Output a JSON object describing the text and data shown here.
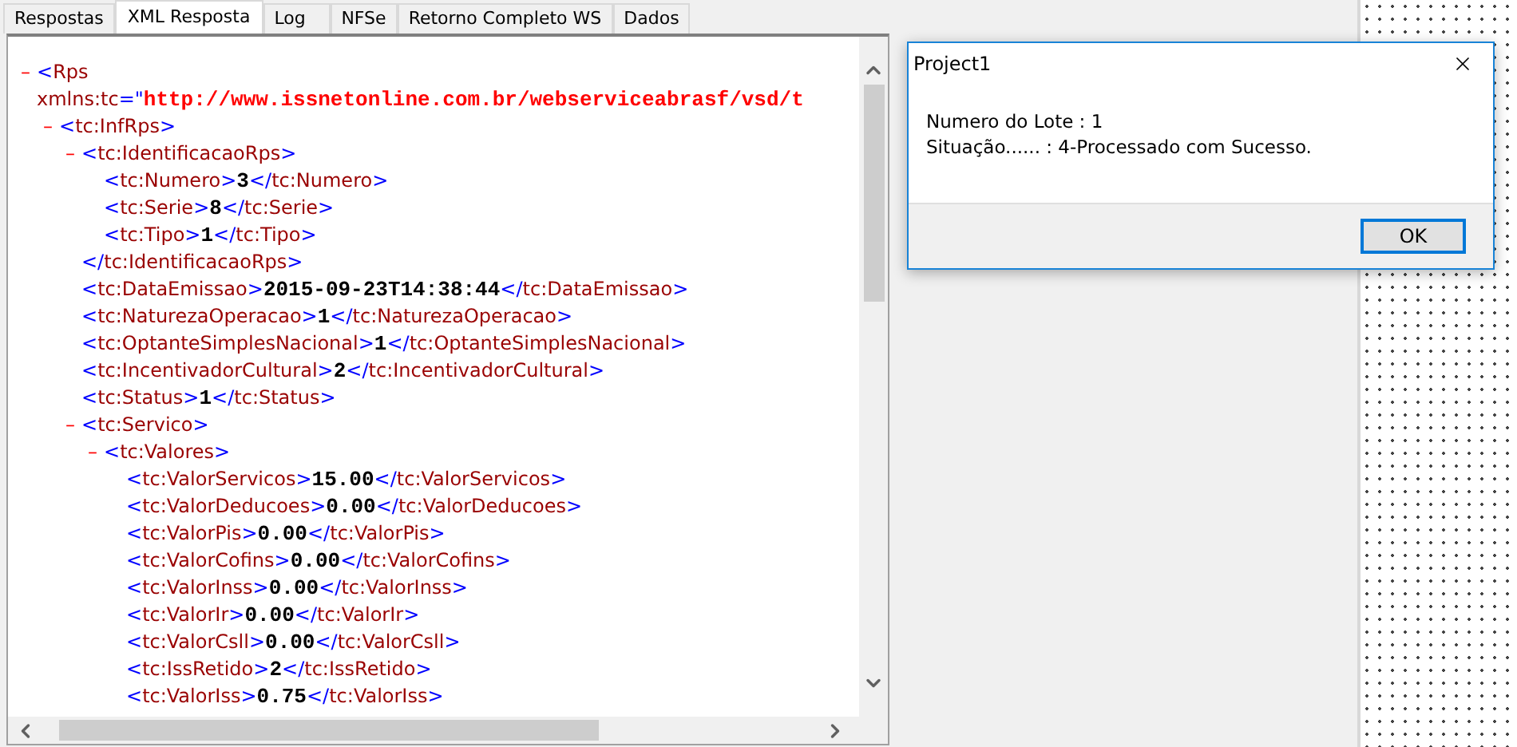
{
  "tabs": [
    {
      "label": "Respostas",
      "selected": false
    },
    {
      "label": "XML Resposta",
      "selected": true
    },
    {
      "label": "Log",
      "selected": false
    },
    {
      "label": "NFSe",
      "selected": false
    },
    {
      "label": "Retorno Completo WS",
      "selected": false
    },
    {
      "label": "Dados",
      "selected": false
    }
  ],
  "xml": {
    "toggle": "–",
    "expanded": true,
    "open": "<Rps",
    "attribute": {
      "name": "xmlns:tc",
      "sep": "=\"",
      "value": "http://www.issnetonline.com.br/webserviceabrasf/vsd/t"
    },
    "children": [
      {
        "toggle": "–",
        "expanded": true,
        "open": "<tc:InfRps>",
        "children": [
          {
            "toggle": "–",
            "expanded": true,
            "open": "<tc:IdentificacaoRps>",
            "close": "</tc:IdentificacaoRps>",
            "children": [
              {
                "open": "<tc:Numero>",
                "value": "3",
                "close": "</tc:Numero>"
              },
              {
                "open": "<tc:Serie>",
                "value": "8",
                "close": "</tc:Serie>"
              },
              {
                "open": "<tc:Tipo>",
                "value": "1",
                "close": "</tc:Tipo>"
              }
            ]
          },
          {
            "open": "<tc:DataEmissao>",
            "value": "2015-09-23T14:38:44",
            "close": "</tc:DataEmissao>"
          },
          {
            "open": "<tc:NaturezaOperacao>",
            "value": "1",
            "close": "</tc:NaturezaOperacao>"
          },
          {
            "open": "<tc:OptanteSimplesNacional>",
            "value": "1",
            "close": "</tc:OptanteSimplesNacional>"
          },
          {
            "open": "<tc:IncentivadorCultural>",
            "value": "2",
            "close": "</tc:IncentivadorCultural>"
          },
          {
            "open": "<tc:Status>",
            "value": "1",
            "close": "</tc:Status>"
          },
          {
            "toggle": "–",
            "expanded": true,
            "open": "<tc:Servico>",
            "children": [
              {
                "toggle": "–",
                "expanded": true,
                "open": "<tc:Valores>",
                "children": [
                  {
                    "open": "<tc:ValorServicos>",
                    "value": "15.00",
                    "close": "</tc:ValorServicos>"
                  },
                  {
                    "open": "<tc:ValorDeducoes>",
                    "value": "0.00",
                    "close": "</tc:ValorDeducoes>"
                  },
                  {
                    "open": "<tc:ValorPis>",
                    "value": "0.00",
                    "close": "</tc:ValorPis>"
                  },
                  {
                    "open": "<tc:ValorCofins>",
                    "value": "0.00",
                    "close": "</tc:ValorCofins>"
                  },
                  {
                    "open": "<tc:ValorInss>",
                    "value": "0.00",
                    "close": "</tc:ValorInss>"
                  },
                  {
                    "open": "<tc:ValorIr>",
                    "value": "0.00",
                    "close": "</tc:ValorIr>"
                  },
                  {
                    "open": "<tc:ValorCsll>",
                    "value": "0.00",
                    "close": "</tc:ValorCsll>"
                  },
                  {
                    "open": "<tc:IssRetido>",
                    "value": "2",
                    "close": "</tc:IssRetido>"
                  },
                  {
                    "open": "<tc:ValorIss>",
                    "value": "0.75",
                    "close": "</tc:ValorIss>"
                  }
                ]
              }
            ]
          }
        ]
      }
    ]
  },
  "dialog": {
    "title": "Project1",
    "lines": [
      "Numero do Lote : 1",
      "Situação...... : 4-Processado com Sucesso."
    ],
    "button": "OK"
  }
}
